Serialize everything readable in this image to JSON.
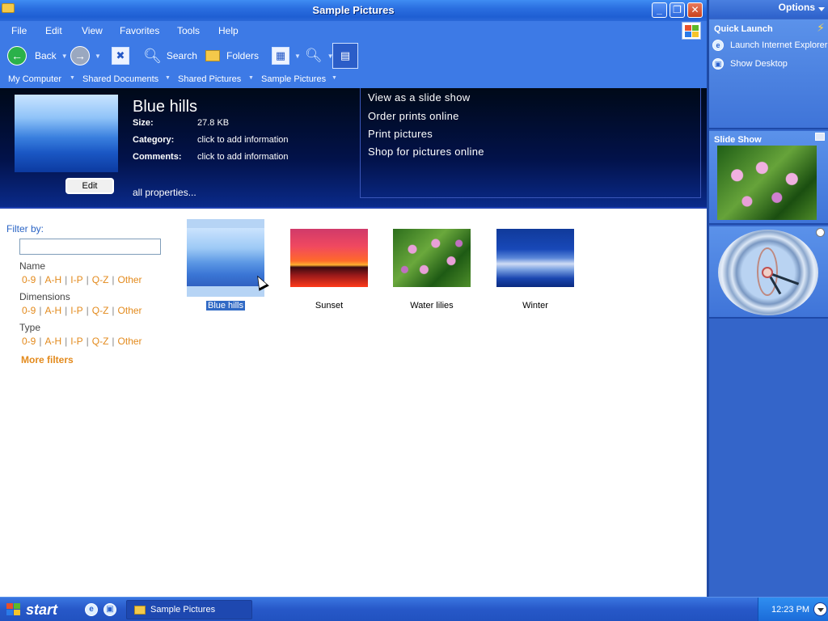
{
  "window": {
    "title": "Sample Pictures",
    "controls": {
      "minimize": "_",
      "maximize": "❐",
      "close": "✕"
    }
  },
  "menu": [
    "File",
    "Edit",
    "View",
    "Favorites",
    "Tools",
    "Help"
  ],
  "toolbar": {
    "back": "Back",
    "search": "Search",
    "folders": "Folders"
  },
  "breadcrumb": [
    "My Computer",
    "Shared Documents",
    "Shared Pictures",
    "Sample Pictures"
  ],
  "preview": {
    "title": "Blue hills",
    "edit_label": "Edit",
    "fields": [
      {
        "label": "Size:",
        "value": "27.8 KB"
      },
      {
        "label": "Category:",
        "value": "click to add information"
      },
      {
        "label": "Comments:",
        "value": "click to add information"
      }
    ],
    "all_properties": "all properties...",
    "tasks": [
      "View as a slide show",
      "Order prints online",
      "Print pictures",
      "Shop for pictures online"
    ]
  },
  "filter": {
    "title": "Filter by:",
    "search_value": "",
    "groups": [
      {
        "name": "Name",
        "links": [
          "0-9",
          "A-H",
          "I-P",
          "Q-Z",
          "Other"
        ]
      },
      {
        "name": "Dimensions",
        "links": [
          "0-9",
          "A-H",
          "I-P",
          "Q-Z",
          "Other"
        ]
      },
      {
        "name": "Type",
        "links": [
          "0-9",
          "A-H",
          "I-P",
          "Q-Z",
          "Other"
        ]
      }
    ],
    "more": "More filters"
  },
  "thumbnails": [
    "Blue hills",
    "Sunset",
    "Water lilies",
    "Winter"
  ],
  "sidebar": {
    "options": "Options",
    "quick_launch": {
      "title": "Quick Launch",
      "items": [
        "Launch Internet Explorer",
        "Show Desktop"
      ]
    },
    "slide_show": {
      "title": "Slide Show"
    }
  },
  "taskbar": {
    "start": "start",
    "task": "Sample Pictures",
    "time": "12:23 PM"
  }
}
